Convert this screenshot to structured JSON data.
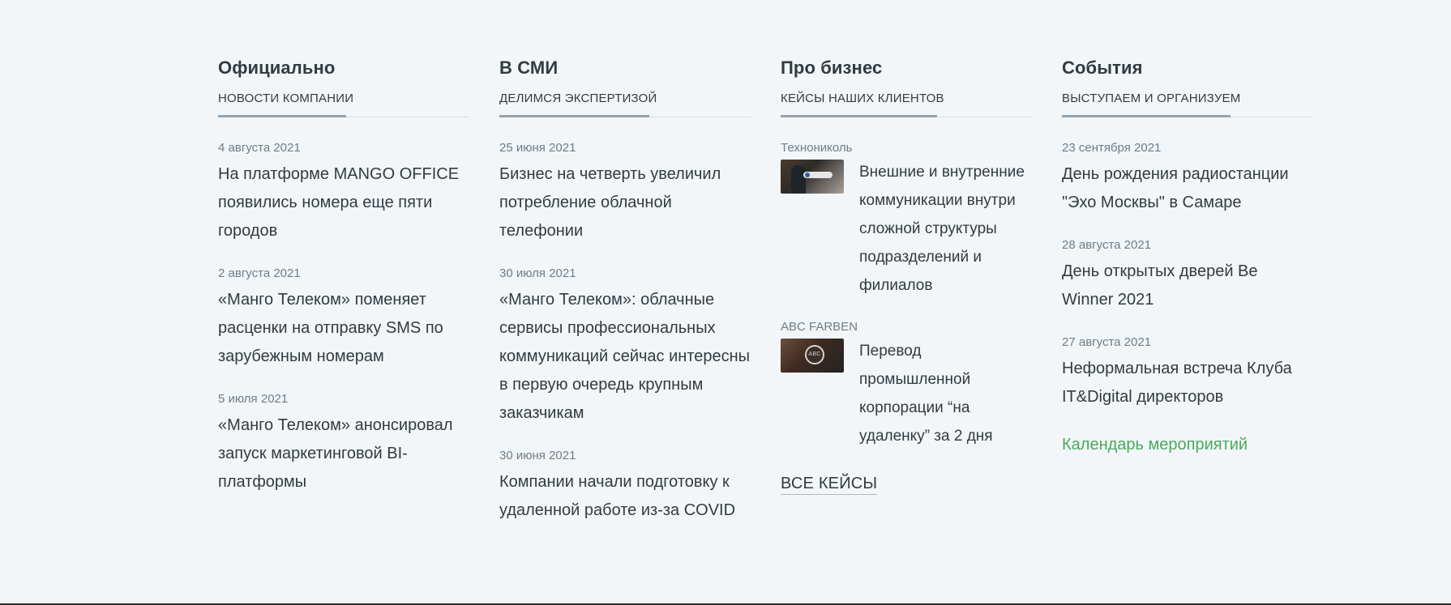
{
  "columns": [
    {
      "title": "Официально",
      "tab": "Новости компании",
      "items": [
        {
          "date": "4 августа 2021",
          "title": "На платформе MANGO OFFICE появились номера еще пяти городов"
        },
        {
          "date": "2 августа 2021",
          "title": "«Манго Телеком» поменяет расценки на отправку SMS по зарубежным номерам"
        },
        {
          "date": "5 июля 2021",
          "title": "«Манго Телеком» анонсировал запуск маркетинговой BI-платформы"
        }
      ]
    },
    {
      "title": "В СМИ",
      "tab": "Делимся экспертизой",
      "items": [
        {
          "date": "25 июня 2021",
          "title": "Бизнес на четверть увеличил потребление облачной телефонии"
        },
        {
          "date": "30 июля 2021",
          "title": "«Манго Телеком»: облачные сервисы профессиональных коммуникаций сейчас интересны в первую очередь крупным заказчикам"
        },
        {
          "date": "30 июня 2021",
          "title": "Компании начали подготовку к удаленной работе из-за COVID"
        }
      ]
    },
    {
      "title": "Про бизнес",
      "tab": "Кейсы наших клиентов",
      "cases": [
        {
          "client": "Технониколь",
          "title": "Внешние и внутренние коммуникации внутри сложной структуры подразделений и филиалов",
          "icon": "case-thumbnail"
        },
        {
          "client": "ABC FARBEN",
          "title": "Перевод промышленной корпорации “на удаленку” за 2 дня",
          "icon": "case-thumbnail"
        }
      ],
      "link": "Все кейсы"
    },
    {
      "title": "События",
      "tab": "Выступаем и организуем",
      "items": [
        {
          "date": "23 сентября 2021",
          "title": "День рождения радиостанции \"Эхо Москвы\" в Самаре"
        },
        {
          "date": "28 августа 2021",
          "title": "День открытых дверей Be Winner 2021"
        },
        {
          "date": "27 августа 2021",
          "title": "Неформальная встреча Клуба IT&Digital директоров"
        }
      ],
      "link": "Календарь мероприятий"
    }
  ],
  "colors": {
    "background": "#f2f6f9",
    "text": "#333b40",
    "muted": "#6f7c86",
    "active_tab": "#93a4b2",
    "accent": "#4aaa5a"
  }
}
